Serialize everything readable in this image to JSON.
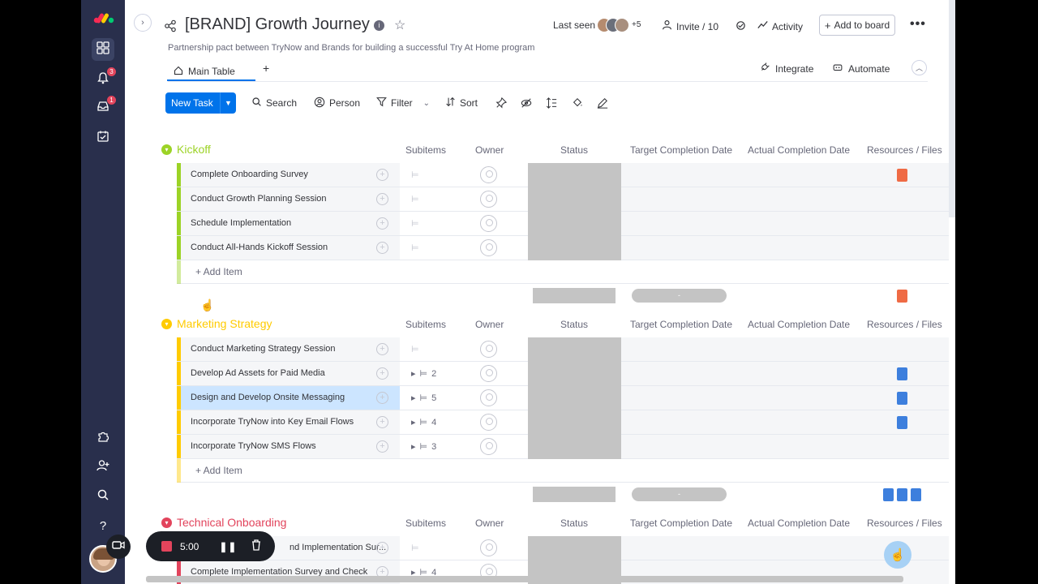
{
  "board": {
    "title": "[BRAND] Growth Journey",
    "description": "Partnership pact between TryNow and Brands for building a successful Try At Home program"
  },
  "header": {
    "last_seen_label": "Last seen",
    "last_seen_more": "+5",
    "invite_label": "Invite / 10",
    "activity_label": "Activity",
    "add_to_board_label": "Add to board"
  },
  "tabs": {
    "main_table_label": "Main Table",
    "add_tab": "+",
    "integrate_label": "Integrate",
    "automate_label": "Automate"
  },
  "toolbar": {
    "new_task_label": "New Task",
    "search_label": "Search",
    "person_label": "Person",
    "filter_label": "Filter",
    "sort_label": "Sort"
  },
  "rail": {
    "notifications_badge": "3",
    "inbox_badge": "1"
  },
  "columns": {
    "subitems": "Subitems",
    "owner": "Owner",
    "status": "Status",
    "target": "Target Completion Date",
    "actual": "Actual Completion Date",
    "files": "Resources / Files"
  },
  "groups": [
    {
      "title": "Kickoff",
      "color": "#9cd326",
      "add_item": "+ Add Item",
      "summary_pill": "-",
      "items": [
        {
          "name": "Complete Onboarding Survey",
          "subitems": "",
          "file": "pdf"
        },
        {
          "name": "Conduct Growth Planning Session",
          "subitems": "",
          "file": ""
        },
        {
          "name": "Schedule Implementation",
          "subitems": "",
          "file": ""
        },
        {
          "name": "Conduct All-Hands Kickoff Session",
          "subitems": "",
          "file": ""
        }
      ]
    },
    {
      "title": "Marketing Strategy",
      "color": "#ffcb00",
      "add_item": "+ Add Item",
      "summary_pill": "-",
      "items": [
        {
          "name": "Conduct Marketing Strategy Session",
          "subitems": "",
          "file": ""
        },
        {
          "name": "Develop Ad Assets for Paid Media",
          "subitems": "2",
          "file": "doc"
        },
        {
          "name": "Design and Develop Onsite Messaging",
          "subitems": "5",
          "file": "doc"
        },
        {
          "name": "Incorporate TryNow into Key Email Flows",
          "subitems": "4",
          "file": "doc"
        },
        {
          "name": "Incorporate TryNow SMS Flows",
          "subitems": "3",
          "file": ""
        }
      ]
    },
    {
      "title": "Technical Onboarding",
      "color": "#e2445c",
      "items": [
        {
          "name": "nd Implementation Sur...",
          "subitems": "",
          "file": ""
        },
        {
          "name": "Complete Implementation Survey and Check",
          "subitems": "4",
          "file": ""
        }
      ]
    }
  ],
  "recorder": {
    "time": "5:00"
  },
  "colors": {
    "accent": "#0073ea",
    "rail_bg": "#292f4c",
    "status_empty": "#c4c4c4"
  }
}
